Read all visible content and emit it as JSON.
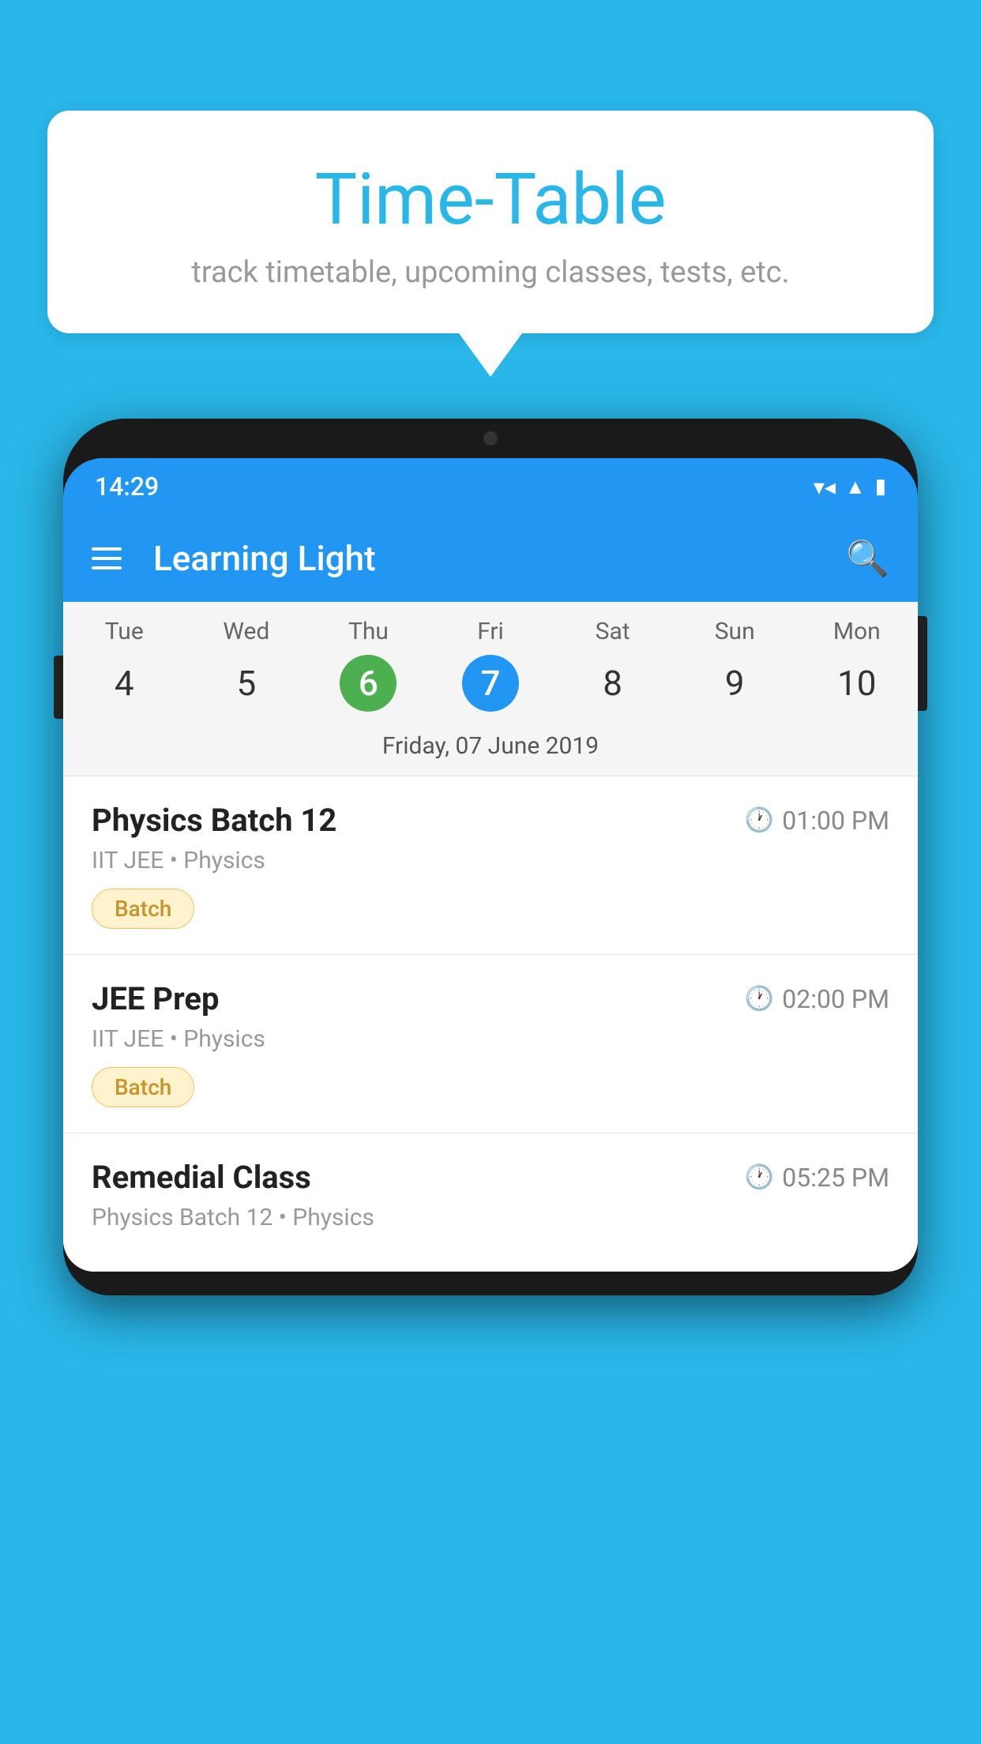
{
  "background_color": "#29b6e8",
  "speech_bubble": {
    "title": "Time-Table",
    "subtitle": "track timetable, upcoming classes, tests, etc."
  },
  "status_bar": {
    "time": "14:29",
    "wifi": "▼▲",
    "battery": "▮"
  },
  "app_bar": {
    "title": "Learning Light",
    "search_label": "search"
  },
  "calendar": {
    "days": [
      {
        "name": "Tue",
        "number": "4",
        "state": "normal"
      },
      {
        "name": "Wed",
        "number": "5",
        "state": "normal"
      },
      {
        "name": "Thu",
        "number": "6",
        "state": "today"
      },
      {
        "name": "Fri",
        "number": "7",
        "state": "selected"
      },
      {
        "name": "Sat",
        "number": "8",
        "state": "normal"
      },
      {
        "name": "Sun",
        "number": "9",
        "state": "normal"
      },
      {
        "name": "Mon",
        "number": "10",
        "state": "normal"
      }
    ],
    "selected_date_label": "Friday, 07 June 2019"
  },
  "schedule": [
    {
      "title": "Physics Batch 12",
      "time": "01:00 PM",
      "subtitle": "IIT JEE • Physics",
      "badge": "Batch"
    },
    {
      "title": "JEE Prep",
      "time": "02:00 PM",
      "subtitle": "IIT JEE • Physics",
      "badge": "Batch"
    },
    {
      "title": "Remedial Class",
      "time": "05:25 PM",
      "subtitle": "Physics Batch 12 • Physics",
      "badge": ""
    }
  ]
}
